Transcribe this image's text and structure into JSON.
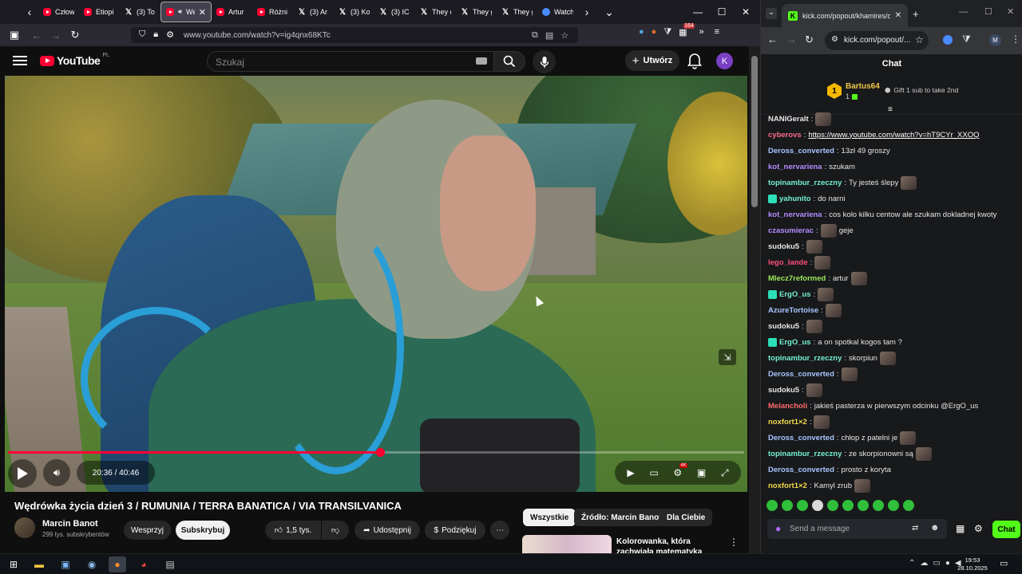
{
  "firefox": {
    "tabs": [
      {
        "label": "Człow",
        "icon": "youtube"
      },
      {
        "label": "Etiopi",
        "icon": "youtube"
      },
      {
        "label": "(3) To",
        "icon": "x"
      },
      {
        "label": "We",
        "icon": "youtube",
        "active": true
      },
      {
        "label": "Artur",
        "icon": "youtube"
      },
      {
        "label": "Różni",
        "icon": "youtube"
      },
      {
        "label": "(3) Ar",
        "icon": "x"
      },
      {
        "label": "(3) Ko",
        "icon": "x"
      },
      {
        "label": "(3) IC",
        "icon": "x"
      },
      {
        "label": "They c",
        "icon": "x"
      },
      {
        "label": "They g",
        "icon": "x"
      },
      {
        "label": "They g",
        "icon": "x"
      },
      {
        "label": "Watch",
        "icon": "ai"
      }
    ],
    "url": "www.youtube.com/watch?v=ig4qnx68KTc",
    "extension_badge": "164"
  },
  "youtube": {
    "logo_text": "YouTube",
    "country_code": "PL",
    "search_placeholder": "Szukaj",
    "create_label": "Utwórz",
    "avatar_letter": "K",
    "player": {
      "current_time": "20:36",
      "duration": "40:46",
      "time_display": "20:36 / 40:46",
      "progress": 0.505,
      "quality_badge": "4K"
    },
    "video_title": "Wędrówka życia dzień 3 / RUMUNIA / TERRA BANATICA / VIA TRANSILVANICA",
    "channel_name": "Marcin Banot",
    "subscribers": "299 tys. subskrybentów",
    "support_label": "Wesprzyj",
    "subscribe_label": "Subskrybuj",
    "likes": "1,5 tys.",
    "share_label": "Udostępnij",
    "thanks_label": "Podziękuj",
    "chips": [
      "Wszystkie",
      "Źródło: Marcin Banot",
      "Dla Ciebie"
    ],
    "recommended_title": "Kolorowanka, która zachwiała matematyką"
  },
  "chrome": {
    "tab_title": "kick.com/popout/khamires/chat",
    "omnibox": "kick.com/popout/...",
    "profile_letter": "M"
  },
  "kick": {
    "header": "Chat",
    "pinned_user": "Bartus64",
    "pinned_rank": "1",
    "pinned_count": "1",
    "gift_text": "Gift 1 sub to take 2nd",
    "messages": [
      {
        "user": "NANIGeralt",
        "color": "#e6e6e6",
        "text": "",
        "emote": true
      },
      {
        "user": "cyberovs",
        "color": "#ff6b8b",
        "text": "https://www.youtube.com/watch?v=hT9CYr_XXOQ",
        "link": true
      },
      {
        "user": "Deross_converted",
        "color": "#a8c5ff",
        "text": "13zł 49 groszy"
      },
      {
        "user": "kot_nervariena",
        "color": "#b48cff",
        "text": "szukam"
      },
      {
        "user": "topinambur_rzeczny",
        "color": "#74f1d2",
        "text": "Ty jesteś ślepy",
        "emote_after": true
      },
      {
        "user": "yahunito",
        "color": "#74f1d2",
        "text": "do narni",
        "sub": true
      },
      {
        "user": "kot_nervariena",
        "color": "#b48cff",
        "text": "cos kolo kilku centow ale szukam dokladnej kwoty"
      },
      {
        "user": "czasumierac",
        "color": "#b48cff",
        "text": "geje",
        "emote": true
      },
      {
        "user": "sudoku5",
        "color": "#e6e6e6",
        "text": "",
        "emote": true
      },
      {
        "user": "lego_lande",
        "color": "#ff4f7a",
        "text": "",
        "emote": true
      },
      {
        "user": "Mlecz7reformed",
        "color": "#9bea5a",
        "text": "artur",
        "emote_after": true
      },
      {
        "user": "ErgO_us",
        "color": "#74f1d2",
        "text": "",
        "emote": true,
        "sub": true
      },
      {
        "user": "AzureTortoise",
        "color": "#a8c5ff",
        "text": "",
        "emote": true
      },
      {
        "user": "sudoku5",
        "color": "#e6e6e6",
        "text": "",
        "emote": true
      },
      {
        "user": "ErgO_us",
        "color": "#74f1d2",
        "text": "a on spotkal kogos tam ?",
        "sub": true
      },
      {
        "user": "topinambur_rzeczny",
        "color": "#74f1d2",
        "text": "skorpiun",
        "emote_after": true
      },
      {
        "user": "Deross_converted",
        "color": "#a8c5ff",
        "text": "",
        "emote": true
      },
      {
        "user": "sudoku5",
        "color": "#e6e6e6",
        "text": "",
        "emote": true
      },
      {
        "user": "Melancholi",
        "color": "#ff6b6b",
        "text": "jakieś pasterza w pierwszym odcinku @ErgO_us"
      },
      {
        "user": "noxfort1×2",
        "color": "#f0d84a",
        "text": "",
        "emote": true
      },
      {
        "user": "Deross_converted",
        "color": "#a8c5ff",
        "text": "chłop z patelni je",
        "emote_after": true
      },
      {
        "user": "topinambur_rzeczny",
        "color": "#74f1d2",
        "text": "ze skorpionowni są",
        "emote_after": true
      },
      {
        "user": "Deross_converted",
        "color": "#a8c5ff",
        "text": "prosto z koryta"
      },
      {
        "user": "noxfort1×2",
        "color": "#f0d84a",
        "text": "Kamyl zrub",
        "emote_after": true
      }
    ],
    "input_placeholder": "Send a message",
    "send_label": "Chat"
  },
  "taskbar": {
    "time": "19:53",
    "date": "28.10.2025"
  },
  "colors": {
    "youtube_red": "#ff0033",
    "kick_green": "#53fc18",
    "chat_bg": "#18191b"
  }
}
